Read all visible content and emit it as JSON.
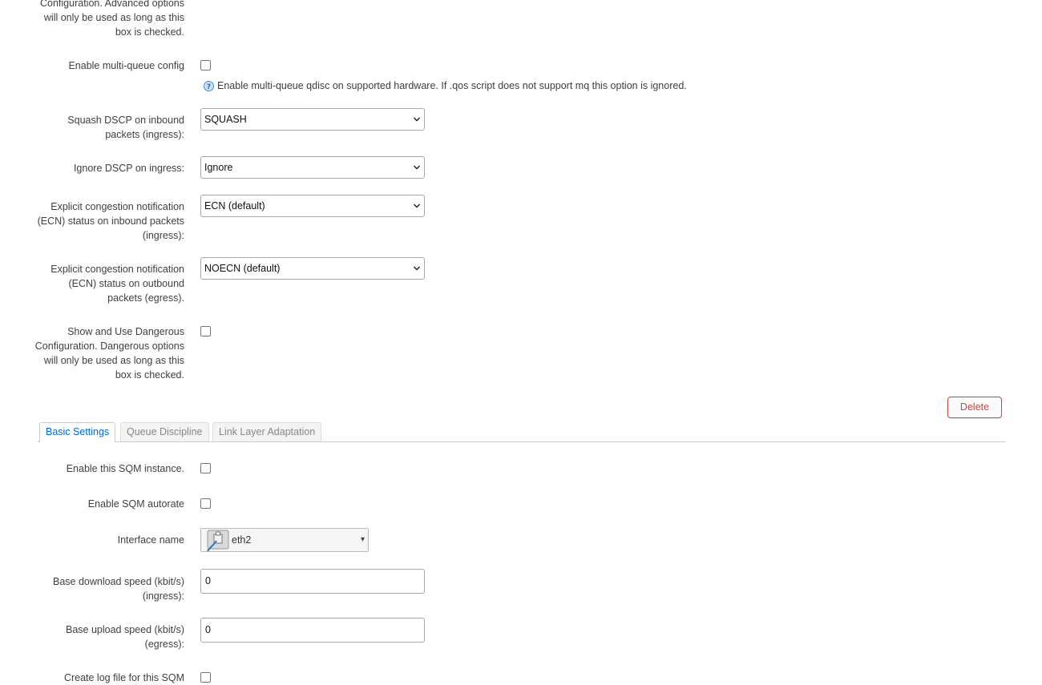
{
  "top_section": {
    "advanced_label_tail": "Configuration. Advanced options will only be used as long as this box is checked.",
    "multiqueue": {
      "label": "Enable multi-queue config",
      "checked": false,
      "hint": "Enable multi-queue qdisc on supported hardware. If .qos script does not support mq this option is ignored."
    },
    "squash_dscp": {
      "label": "Squash DSCP on inbound packets (ingress):",
      "value": "SQUASH"
    },
    "ignore_dscp": {
      "label": "Ignore DSCP on ingress:",
      "value": "Ignore"
    },
    "ecn_ingress": {
      "label": "Explicit congestion notification (ECN) status on inbound packets (ingress):",
      "value": "ECN (default)"
    },
    "ecn_egress": {
      "label": "Explicit congestion notification (ECN) status on outbound packets (egress).",
      "value": "NOECN (default)"
    },
    "dangerous": {
      "label": "Show and Use Dangerous Configuration. Dangerous options will only be used as long as this box is checked.",
      "checked": false
    },
    "delete_label": "Delete"
  },
  "tabs": [
    {
      "label": "Basic Settings",
      "active": true
    },
    {
      "label": "Queue Discipline",
      "active": false
    },
    {
      "label": "Link Layer Adaptation",
      "active": false
    }
  ],
  "basic": {
    "enable_instance": {
      "label": "Enable this SQM instance.",
      "checked": false
    },
    "enable_autorate": {
      "label": "Enable SQM autorate",
      "checked": false
    },
    "interface": {
      "label": "Interface name",
      "value": "eth2"
    },
    "download": {
      "label": "Base download speed (kbit/s) (ingress):",
      "value": "0"
    },
    "upload": {
      "label": "Base upload speed (kbit/s) (egress):",
      "value": "0"
    },
    "logfile": {
      "label": "Create log file for this SQM",
      "checked": false
    }
  },
  "colors": {
    "accent": "#0069d6",
    "danger": "#cc4444"
  },
  "icons": {
    "hint": "help-icon",
    "interface": "ethernet-port-icon"
  }
}
